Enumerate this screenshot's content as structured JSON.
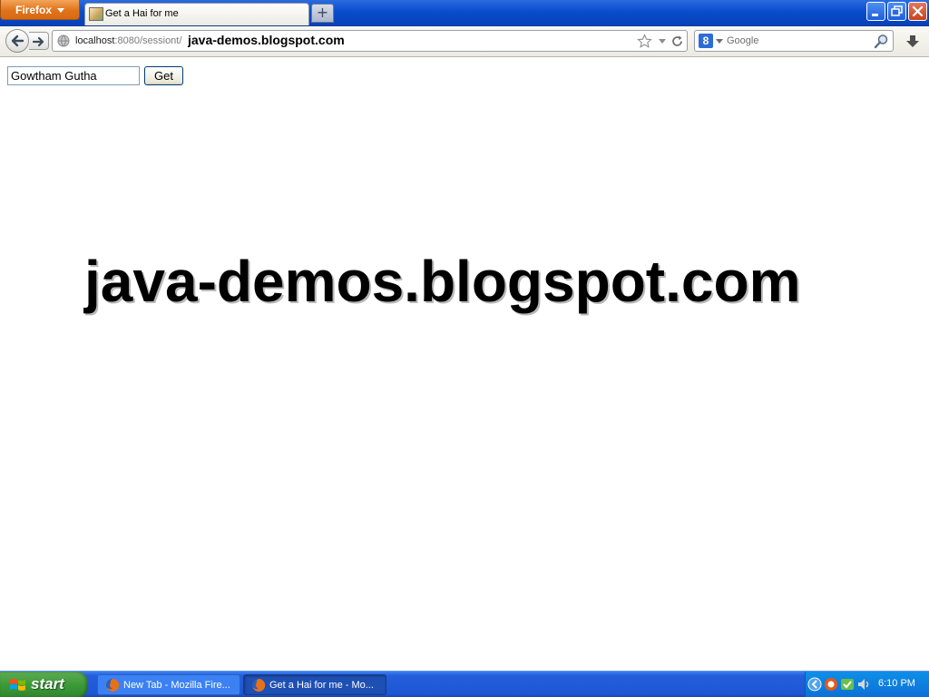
{
  "browser": {
    "menu_button": "Firefox",
    "active_tab": {
      "title": "Get a Hai for me"
    },
    "new_tab_symbol": "+"
  },
  "nav": {
    "url_host": "localhost",
    "url_rest": ":8080/sessiont/",
    "url_overlay_text": "java-demos.blogspot.com",
    "search": {
      "engine": "8",
      "placeholder": "Google"
    }
  },
  "page": {
    "name_input_value": "Gowtham Gutha",
    "get_button_label": "Get",
    "heading": "java-demos.blogspot.com"
  },
  "taskbar": {
    "start_label": "start",
    "tasks": [
      {
        "label": "New Tab - Mozilla Fire..."
      },
      {
        "label": "Get a Hai for me - Mo..."
      }
    ],
    "clock": "6:10 PM"
  },
  "colors": {
    "titlebar": "#0a4ccc",
    "firefox_button": "#e0731a",
    "taskbar": "#245edb",
    "start_button": "#3c9a38",
    "tray": "#0c6fd6"
  },
  "icons": {
    "tab_favicon": "page-favicon-icon",
    "back": "back-arrow-icon",
    "forward": "forward-arrow-icon",
    "site_identity": "globe-icon",
    "bookmark": "star-icon",
    "history_dropdown": "chevron-down-icon",
    "reload": "reload-icon",
    "search_go": "magnifier-icon",
    "downloads": "download-arrow-icon",
    "windows_flag": "windows-logo-icon",
    "firefox_task": "firefox-icon",
    "window_min": "minimize-icon",
    "window_max": "restore-icon",
    "window_close": "close-icon"
  }
}
